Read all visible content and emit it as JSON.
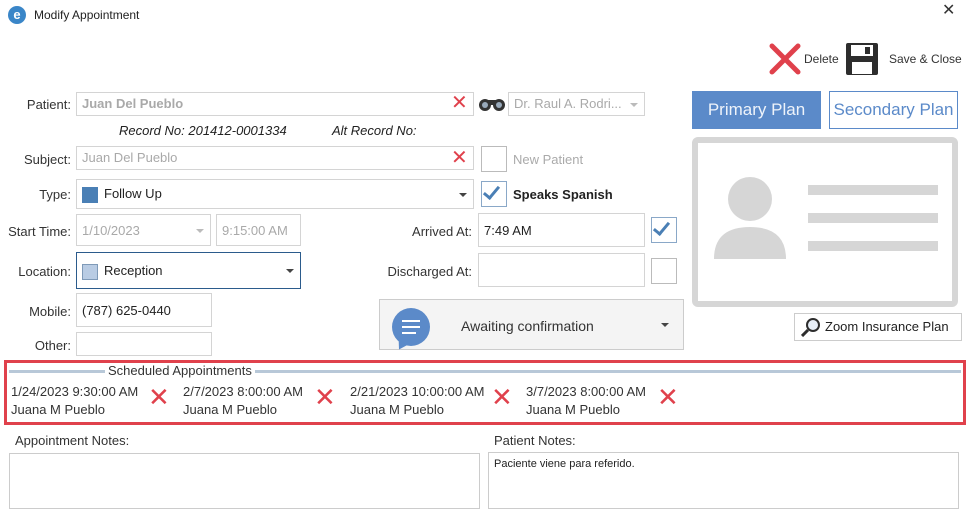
{
  "window": {
    "title": "Modify Appointment",
    "close_glyph": "✕"
  },
  "toolbar": {
    "delete_label": "Delete",
    "save_close_label": "Save & Close"
  },
  "patient": {
    "label": "Patient:",
    "value": "Juan Del Pueblo",
    "record_no": "Record No: 201412-0001334",
    "alt_record_no": "Alt Record No:",
    "doctor": "Dr. Raul A. Rodri..."
  },
  "subject": {
    "label": "Subject:",
    "value": "Juan Del Pueblo"
  },
  "new_patient": {
    "label": "New Patient",
    "checked": false
  },
  "type": {
    "label": "Type:",
    "value": "Follow Up",
    "color": "#4a7fb5"
  },
  "speaks_spanish": {
    "label": "Speaks Spanish",
    "checked": true
  },
  "start": {
    "label": "Start Time:",
    "date": "1/10/2023",
    "time": "9:15:00 AM"
  },
  "arrived": {
    "label": "Arrived At:",
    "value": "7:49 AM",
    "checked": true
  },
  "location": {
    "label": "Location:",
    "value": "Reception",
    "color": "#b9cce4"
  },
  "discharged": {
    "label": "Discharged At:",
    "value": "",
    "checked": false
  },
  "mobile": {
    "label": "Mobile:",
    "value": "(787) 625-0440"
  },
  "other": {
    "label": "Other:",
    "value": ""
  },
  "status": {
    "value": "Awaiting confirmation"
  },
  "plans": {
    "primary": "Primary Plan",
    "secondary": "Secondary Plan",
    "zoom": "Zoom Insurance Plan"
  },
  "scheduled": {
    "title": "Scheduled Appointments",
    "items": [
      {
        "datetime": "1/24/2023 9:30:00 AM",
        "name": "Juana M Pueblo"
      },
      {
        "datetime": "2/7/2023 8:00:00 AM",
        "name": "Juana M Pueblo"
      },
      {
        "datetime": "2/21/2023 10:00:00 AM",
        "name": "Juana M Pueblo"
      },
      {
        "datetime": "3/7/2023 8:00:00 AM",
        "name": "Juana M Pueblo"
      }
    ]
  },
  "notes": {
    "appointment_label": "Appointment Notes:",
    "appointment_value": "",
    "patient_label": "Patient Notes:",
    "patient_value": "Paciente viene para referido."
  },
  "colors": {
    "accent": "#5b8ac9",
    "highlight": "#e0414c",
    "delete_x": "#e0414c"
  }
}
